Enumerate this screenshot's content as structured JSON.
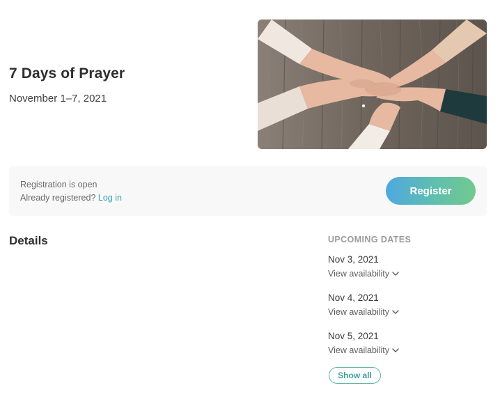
{
  "event": {
    "title": "7 Days of Prayer",
    "dates": "November 1–7, 2021",
    "image": "hands-clasped-photo"
  },
  "registration": {
    "status": "Registration is open",
    "already_registered": "Already registered?",
    "login_label": "Log in",
    "register_label": "Register",
    "accent_color": "#5fbcb2"
  },
  "details": {
    "heading": "Details"
  },
  "upcoming": {
    "heading": "UPCOMING DATES",
    "items": [
      {
        "date": "Nov 3, 2021",
        "availability_label": "View availability"
      },
      {
        "date": "Nov 4, 2021",
        "availability_label": "View availability"
      },
      {
        "date": "Nov 5, 2021",
        "availability_label": "View availability"
      }
    ],
    "show_all_label": "Show all"
  }
}
